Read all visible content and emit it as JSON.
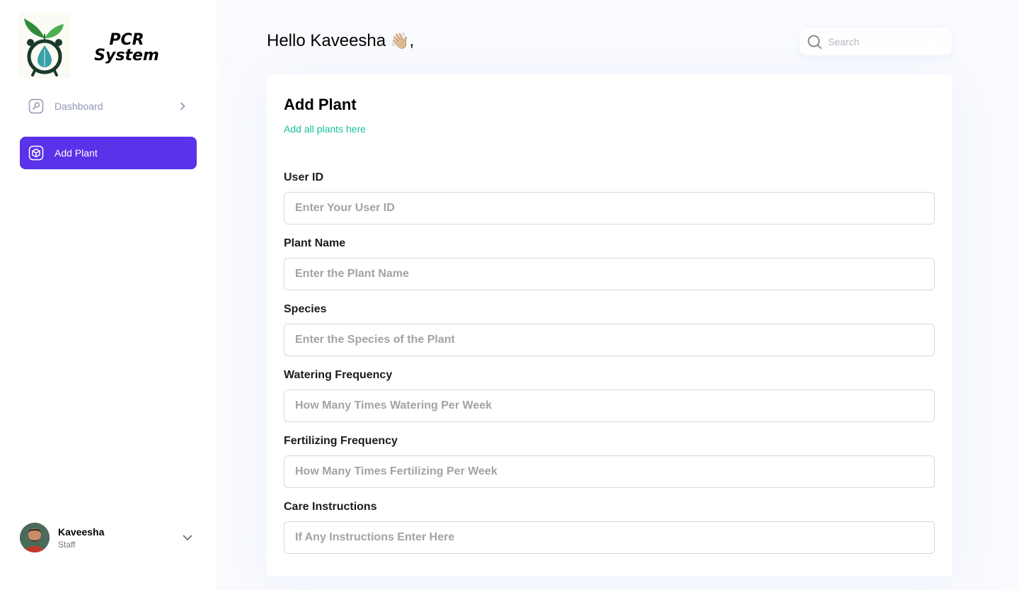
{
  "brand": {
    "name": "PCR System"
  },
  "sidebar": {
    "items": [
      {
        "label": "Dashboard",
        "icon": "key-square-icon"
      },
      {
        "label": "Add Plant",
        "icon": "box-icon"
      }
    ],
    "user": {
      "name": "Kaveesha",
      "role": "Staff"
    }
  },
  "header": {
    "greeting": "Hello Kaveesha",
    "greeting_suffix": ",",
    "wave_emoji": "👋🏼",
    "search_placeholder": "Search"
  },
  "form": {
    "title": "Add Plant",
    "subtitle": "Add all plants here",
    "fields": [
      {
        "label": "User ID",
        "placeholder": "Enter Your User ID",
        "value": ""
      },
      {
        "label": "Plant Name",
        "placeholder": "Enter the Plant Name",
        "value": ""
      },
      {
        "label": "Species",
        "placeholder": "Enter the Species of the Plant",
        "value": ""
      },
      {
        "label": "Watering Frequency",
        "placeholder": "How Many Times Watering Per Week",
        "value": ""
      },
      {
        "label": "Fertilizing Frequency",
        "placeholder": "How Many Times Fertilizing Per Week",
        "value": ""
      },
      {
        "label": "Care Instructions",
        "placeholder": "If Any Instructions Enter Here",
        "value": ""
      }
    ]
  },
  "colors": {
    "accent": "#5932ea",
    "subtitle_green": "#16c098",
    "muted_nav": "#9197b3"
  }
}
